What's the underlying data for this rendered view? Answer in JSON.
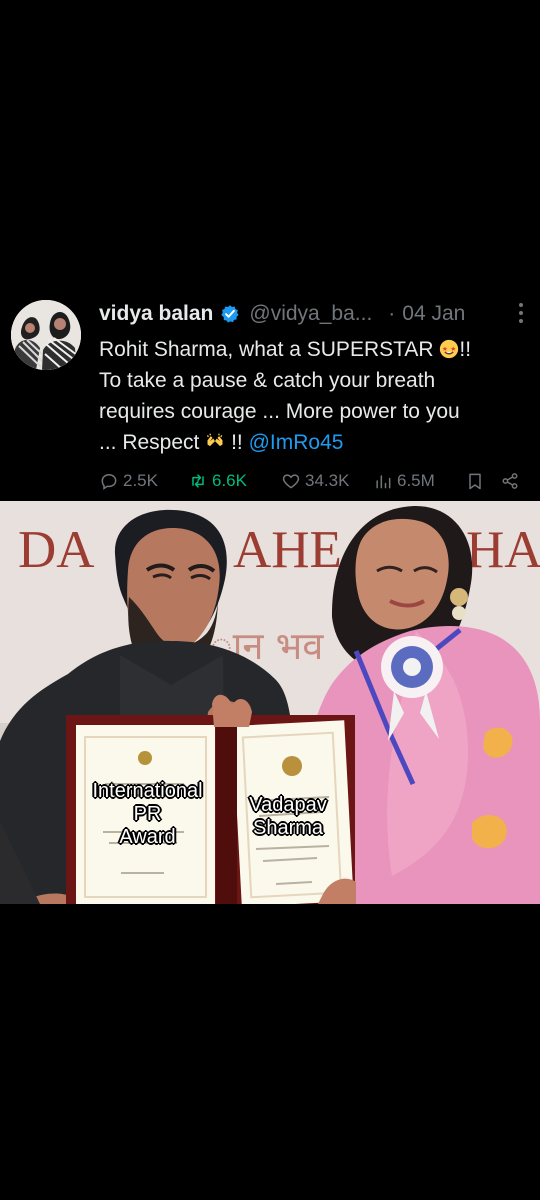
{
  "tweet": {
    "author": {
      "display_name": "vidya balan",
      "handle": "@vidya_ba...",
      "separator": "·",
      "date": "04 Jan",
      "avatar_icon": "profile-avatar",
      "verified_icon": "verified-badge-icon"
    },
    "text": {
      "line1_prefix": "Rohit Sharma, what a SUPERSTAR",
      "line1_suffix": "!!",
      "line2": "To take a pause & catch your breath",
      "line3": "requires courage ... More power to you",
      "line4_prefix": "... Respect",
      "line4_middle": "!!",
      "mention": "@ImRo45"
    },
    "actions": {
      "replies": "2.5K",
      "retweets": "6.6K",
      "likes": "34.3K",
      "views": "6.5M",
      "reply_icon": "reply-icon",
      "retweet_icon": "retweet-icon",
      "like_icon": "heart-icon",
      "views_icon": "views-icon",
      "bookmark_icon": "bookmark-icon",
      "share_icon": "share-icon"
    },
    "menu_icon": "more-options-icon"
  },
  "image": {
    "banner_text": "DA    AHE   HA",
    "hindi_text": "ान  भव",
    "caption_left": "International\nPR\nAward",
    "caption_right": "Vadapav\nSharma"
  },
  "colors": {
    "background": "#000000",
    "text": "#e7e9ea",
    "muted": "#71767b",
    "link": "#1d9bf0",
    "retweet_green": "#00ba7c"
  }
}
